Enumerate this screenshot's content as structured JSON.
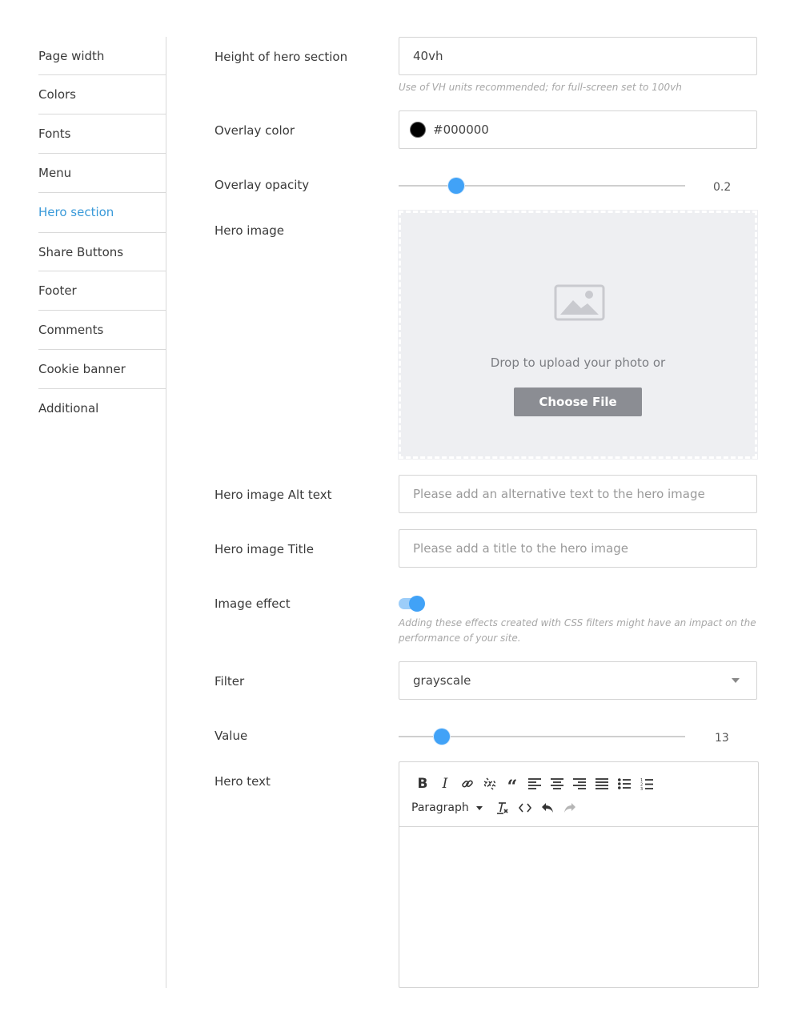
{
  "sidebar": {
    "items": [
      {
        "label": "Page width"
      },
      {
        "label": "Colors"
      },
      {
        "label": "Fonts"
      },
      {
        "label": "Menu"
      },
      {
        "label": "Hero section",
        "active": true
      },
      {
        "label": "Share Buttons"
      },
      {
        "label": "Footer"
      },
      {
        "label": "Comments"
      },
      {
        "label": "Cookie banner"
      },
      {
        "label": "Additional"
      }
    ]
  },
  "form": {
    "hero_height": {
      "label": "Height of hero section",
      "value": "40vh",
      "hint": "Use of VH units recommended; for full-screen set to 100vh"
    },
    "overlay_color": {
      "label": "Overlay color",
      "value": "#000000"
    },
    "overlay_opacity": {
      "label": "Overlay opacity",
      "value": "0.2",
      "fraction": 0.2
    },
    "hero_image": {
      "label": "Hero image",
      "drop_text": "Drop to upload your photo or",
      "button_label": "Choose File"
    },
    "alt_text": {
      "label": "Hero image Alt text",
      "placeholder": "Please add an alternative text to the hero image"
    },
    "image_title": {
      "label": "Hero image Title",
      "placeholder": "Please add a title to the hero image"
    },
    "image_effect": {
      "label": "Image effect",
      "enabled": true,
      "hint": "Adding these effects created with CSS filters might have an impact on the performance of your site."
    },
    "filter": {
      "label": "Filter",
      "value": "grayscale"
    },
    "value": {
      "label": "Value",
      "value": "13",
      "fraction": 0.15
    },
    "hero_text": {
      "label": "Hero text",
      "block_format": "Paragraph"
    }
  },
  "colors": {
    "accent": "#41a2f7",
    "active_link": "#3a9ad9"
  },
  "icons": [
    "image-placeholder-icon",
    "bold-icon",
    "italic-icon",
    "link-icon",
    "unlink-icon",
    "blockquote-icon",
    "align-left-icon",
    "align-center-icon",
    "align-right-icon",
    "align-justify-icon",
    "bullet-list-icon",
    "numbered-list-icon",
    "clear-format-icon",
    "code-icon",
    "undo-icon",
    "redo-icon"
  ]
}
